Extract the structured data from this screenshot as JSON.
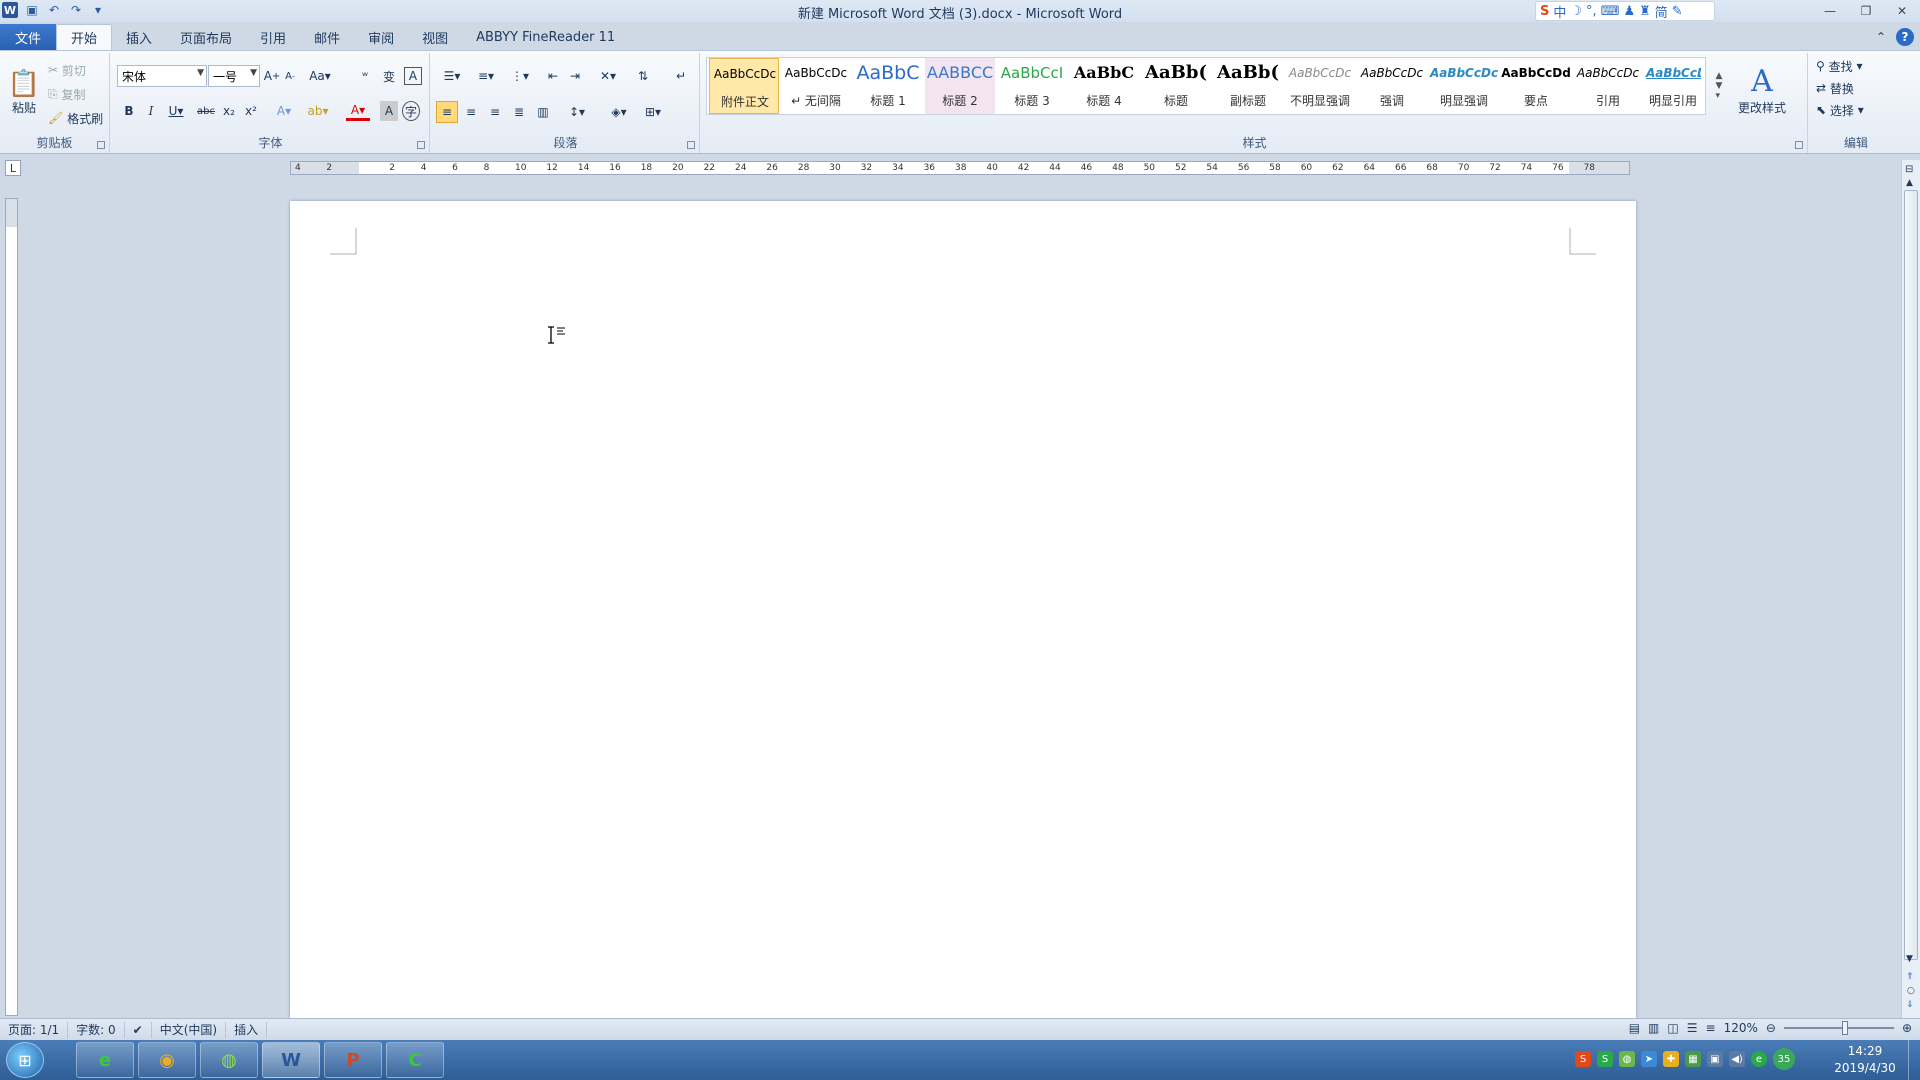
{
  "window": {
    "title": "新建 Microsoft Word 文档 (3).docx - Microsoft Word"
  },
  "tabs": [
    {
      "label": "文件"
    },
    {
      "label": "开始"
    },
    {
      "label": "插入"
    },
    {
      "label": "页面布局"
    },
    {
      "label": "引用"
    },
    {
      "label": "邮件"
    },
    {
      "label": "审阅"
    },
    {
      "label": "视图"
    },
    {
      "label": "ABBYY FineReader 11"
    }
  ],
  "clipboard": {
    "paste": "粘贴",
    "cut": "剪切",
    "copy": "复制",
    "format_painter": "格式刷",
    "label": "剪贴板"
  },
  "font": {
    "family": "宋体",
    "size": "一号",
    "label": "字体"
  },
  "paragraph": {
    "label": "段落"
  },
  "styles": {
    "label": "样式",
    "items": [
      {
        "preview": "AaBbCcDc",
        "name": "附件正文"
      },
      {
        "preview": "AaBbCcDc",
        "name": "↵ 无间隔"
      },
      {
        "preview": "AaBbC",
        "name": "标题 1"
      },
      {
        "preview": "AABBCC",
        "name": "标题 2"
      },
      {
        "preview": "AaBbCcI",
        "name": "标题 3"
      },
      {
        "preview": "AaBbC",
        "name": "标题 4"
      },
      {
        "preview": "AaBb(",
        "name": "标题"
      },
      {
        "preview": "AaBb(",
        "name": "副标题"
      },
      {
        "preview": "AaBbCcDc",
        "name": "不明显强调"
      },
      {
        "preview": "AaBbCcDc",
        "name": "强调"
      },
      {
        "preview": "AaBbCcDc",
        "name": "明显强调"
      },
      {
        "preview": "AaBbCcDd",
        "name": "要点"
      },
      {
        "preview": "AaBbCcDc",
        "name": "引用"
      },
      {
        "preview": "AaBbCcDc",
        "name": "明显引用"
      }
    ],
    "change": "更改样式"
  },
  "editing": {
    "find": "查找",
    "replace": "替换",
    "select": "选择",
    "label": "编辑"
  },
  "sogou": {
    "lang": "中",
    "mode": "简"
  },
  "status": {
    "page": "页面: 1/1",
    "words": "字数: 0",
    "lang": "中文(中国)",
    "mode": "插入",
    "zoom": "120%"
  },
  "taskbar": {
    "time": "14:29",
    "date": "2019/4/30",
    "badge": "35"
  },
  "ruler_ticks": [
    "4",
    "2",
    "",
    "2",
    "4",
    "6",
    "8",
    "10",
    "12",
    "14",
    "16",
    "18",
    "20",
    "22",
    "24",
    "26",
    "28",
    "30",
    "32",
    "34",
    "36",
    "38",
    "40",
    "42",
    "44",
    "46",
    "48",
    "50",
    "52",
    "54",
    "56",
    "58",
    "60",
    "62",
    "64",
    "66",
    "68",
    "70",
    "72",
    "74",
    "76",
    "78"
  ]
}
